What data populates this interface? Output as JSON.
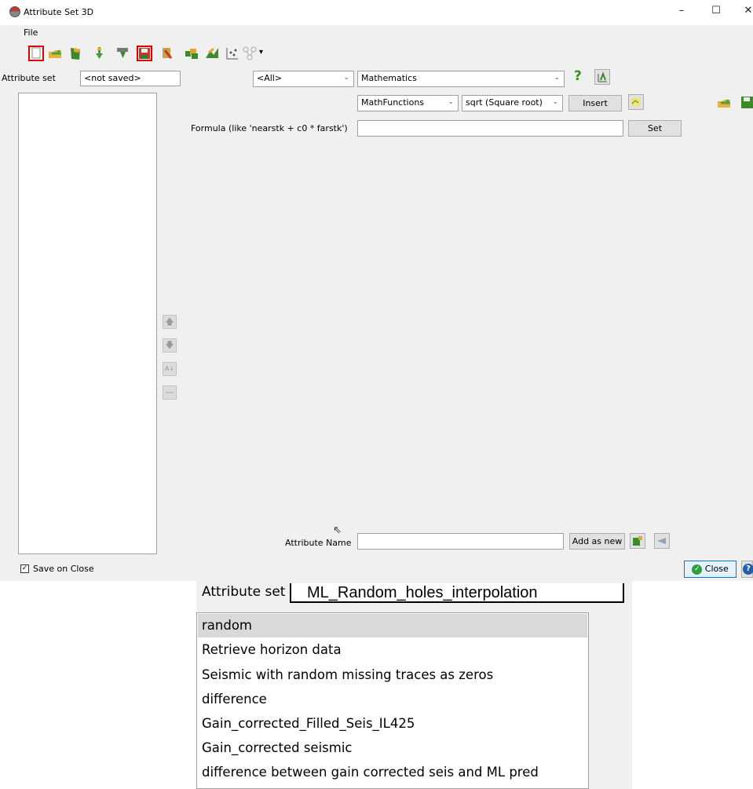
{
  "window": {
    "title": "Attribute Set 3D",
    "minimize": "–",
    "maximize": "☐",
    "close": "✕"
  },
  "menu": {
    "file": "File"
  },
  "toolbar": {
    "icons": [
      "new-set-icon",
      "open-set-icon",
      "default-sets-icon",
      "import-icon",
      "import-from-file-icon",
      "save-set-icon",
      "save-as-icon",
      "evaluate-icon",
      "cross-plot-icon",
      "display-icon",
      "graph-icon"
    ],
    "dropdown_arrow": "▾"
  },
  "attribute_set": {
    "label": "Attribute set",
    "value": "<not saved>"
  },
  "filter_combo": {
    "value": "<All>"
  },
  "attribute_type_combo": {
    "value": "Mathematics"
  },
  "help_button": {
    "label": "?"
  },
  "math": {
    "functions_combo": "MathFunctions",
    "function_combo": "sqrt (Square root)",
    "insert_button": "Insert",
    "formula_label": "Formula (like 'nearstk + c0 * farstk')",
    "formula_value": "",
    "set_button": "Set"
  },
  "side_buttons": {
    "up": "🡅",
    "down": "🡇",
    "sort": "A↓",
    "remove": "—"
  },
  "attribute_name": {
    "label": "Attribute Name",
    "value": "",
    "add_button": "Add as new"
  },
  "footer": {
    "save_on_close_label": "Save on Close",
    "save_on_close_checked": true,
    "close_button": "Close",
    "help": "?"
  },
  "zoom_inset": {
    "attribute_set_label": "Attribute set",
    "attribute_set_value": "ML_Random_holes_interpolation",
    "items": [
      "random",
      "Retrieve horizon data",
      "Seismic with random missing traces as zeros",
      "difference",
      "Gain_corrected_Filled_Seis_IL425",
      "Gain_corrected seismic",
      "difference between gain corrected seis and ML pred"
    ],
    "selected_index": 0
  },
  "colors": {
    "window_bg": "#f0f0f0",
    "highlight": "#d9d9d9",
    "red_outline": "#e00000",
    "close_green": "#2e9e3e",
    "help_blue": "#1f5fa8"
  }
}
